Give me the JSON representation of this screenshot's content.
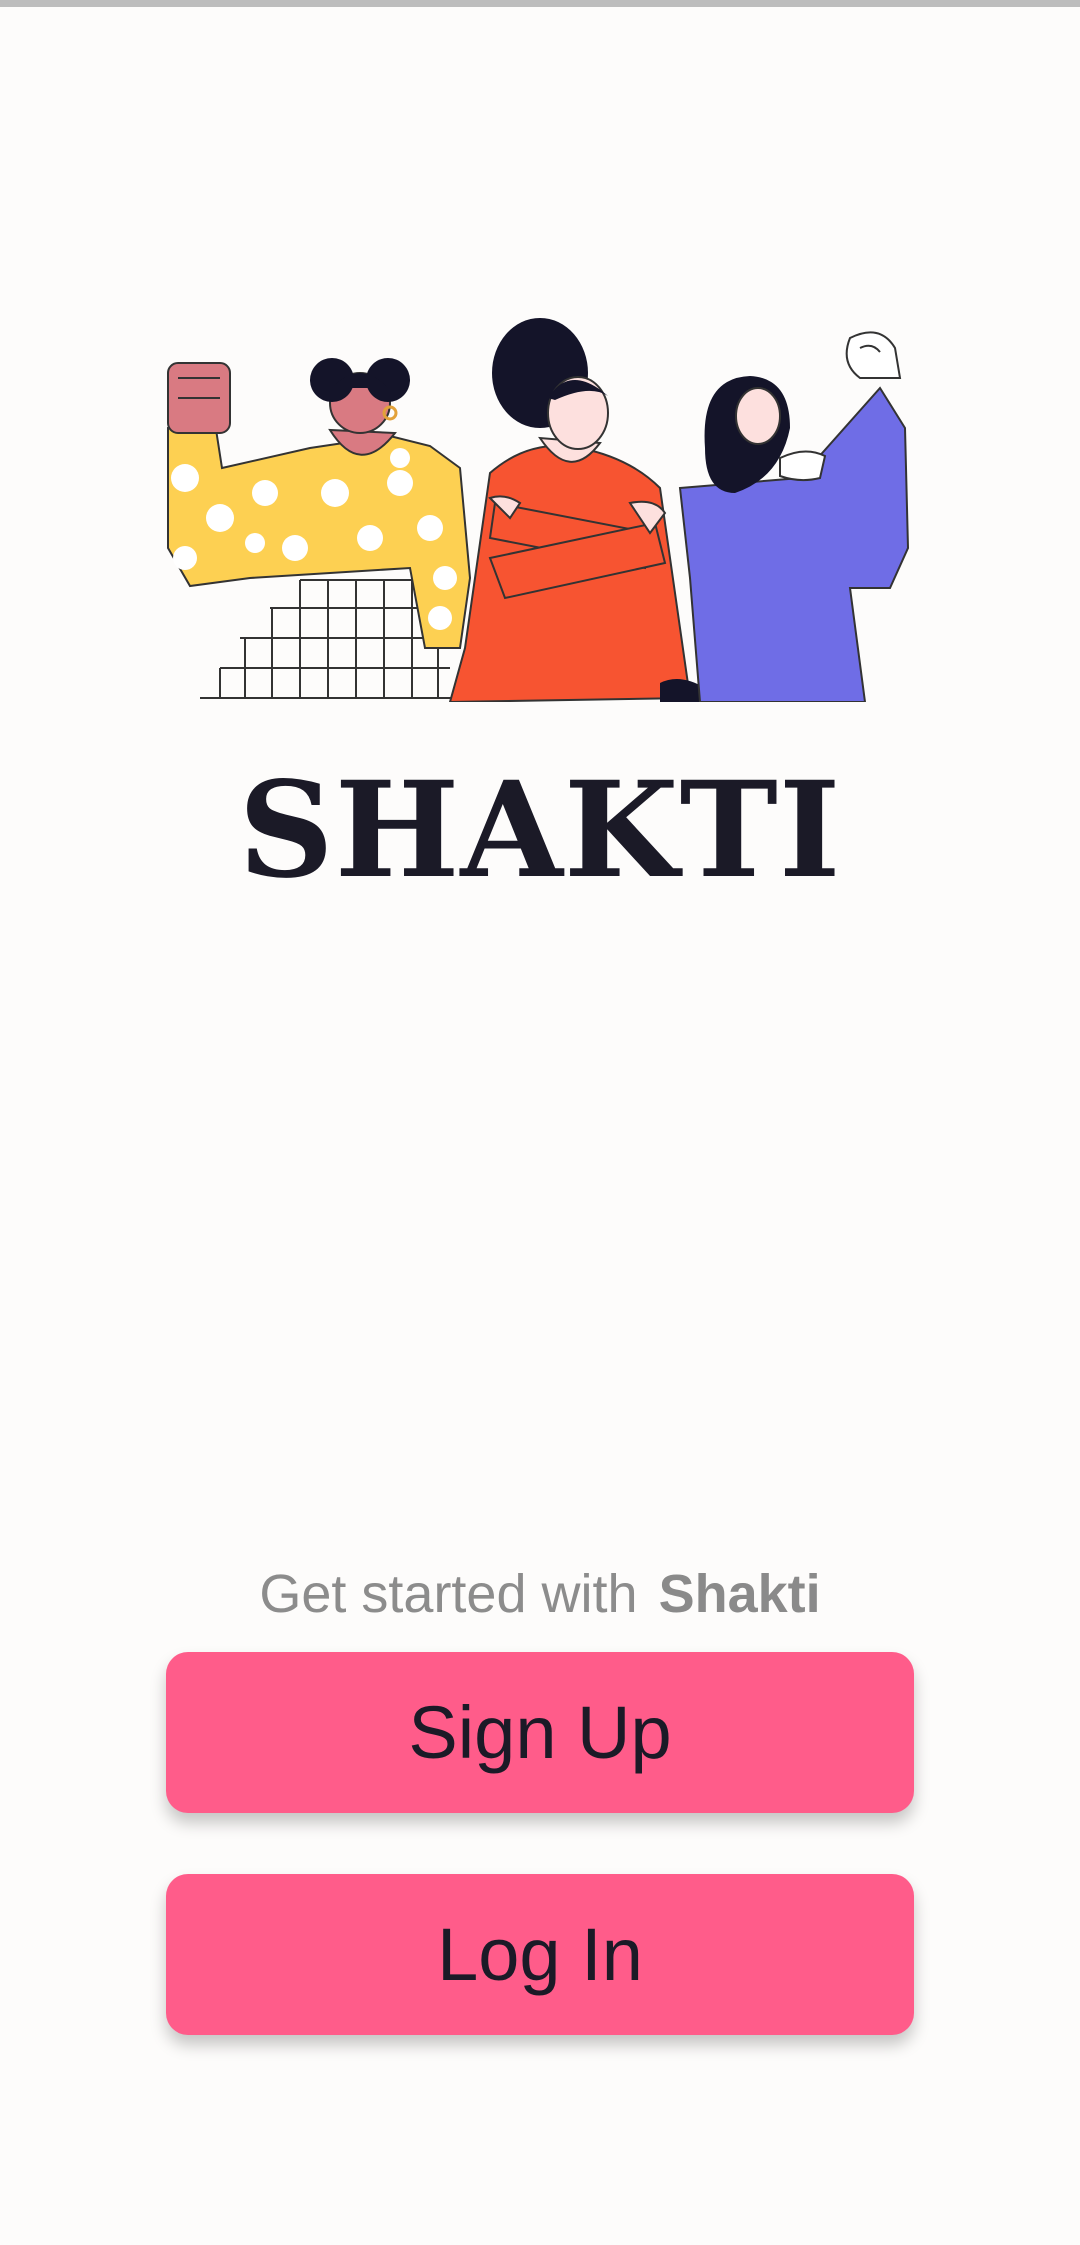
{
  "app": {
    "title": "SHAKTI"
  },
  "hero": {
    "illustration": "three-women-empowerment-illustration"
  },
  "tagline": {
    "prefix": "Get started with",
    "brand": "Shakti"
  },
  "buttons": {
    "signup_label": "Sign Up",
    "login_label": "Log In"
  },
  "colors": {
    "background": "#fdfcfb",
    "button": "#ff5c8a",
    "title": "#1b1a27",
    "tagline": "#8c8c8c"
  }
}
